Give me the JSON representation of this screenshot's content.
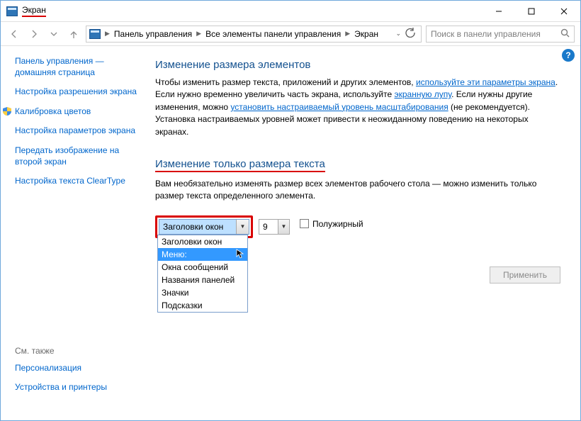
{
  "window": {
    "title": "Экран"
  },
  "breadcrumbs": {
    "items": [
      "Панель управления",
      "Все элементы панели управления",
      "Экран"
    ]
  },
  "search": {
    "placeholder": "Поиск в панели управления"
  },
  "sidebar": {
    "home": "Панель управления — домашняя страница",
    "links": [
      "Настройка разрешения экрана",
      "Калибровка цветов",
      "Настройка параметров экрана",
      "Передать изображение на второй экран",
      "Настройка текста ClearType"
    ],
    "see_also_header": "См. также",
    "see_also": [
      "Персонализация",
      "Устройства и принтеры"
    ]
  },
  "main": {
    "section1_title": "Изменение размера элементов",
    "para1_a": "Чтобы изменить размер текста, приложений и других элементов, ",
    "para1_link1": "используйте эти параметры экрана",
    "para1_b": ". Если нужно временно увеличить часть экрана, используйте ",
    "para1_link2": "экранную лупу",
    "para1_c": ". Если нужны другие изменения, можно ",
    "para1_link3": "установить настраиваемый уровень масштабирования",
    "para1_d": " (не рекомендуется). Установка настраиваемых уровней может привести к неожиданному поведению на некоторых экранах.",
    "section2_title": "Изменение только размера текста",
    "para2": "Вам необязательно изменять размер всех элементов рабочего стола — можно изменить только размер текста определенного элемента.",
    "element_combo": {
      "selected": "Заголовки окон",
      "options": [
        "Заголовки окон",
        "Меню:",
        "Окна сообщений",
        "Названия панелей",
        "Значки",
        "Подсказки"
      ],
      "highlighted_index": 1
    },
    "size_value": "9",
    "bold_label": "Полужирный",
    "apply_label": "Применить"
  }
}
